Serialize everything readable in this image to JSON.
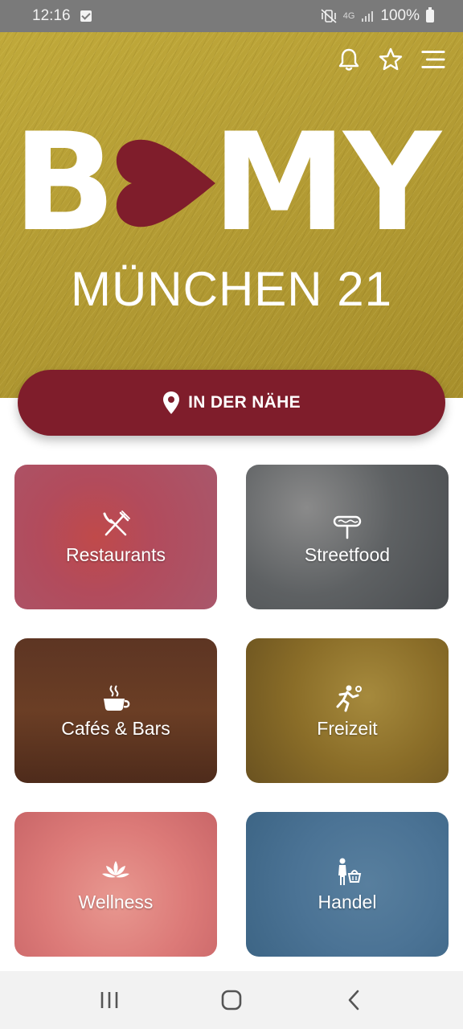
{
  "status_bar": {
    "time": "12:16",
    "network": "4G",
    "battery": "100%"
  },
  "header": {
    "icons": [
      "bell-icon",
      "star-icon",
      "menu-icon"
    ]
  },
  "logo": {
    "left_letter": "B",
    "right_letters": "MY",
    "heart_color": "#7f1d2b",
    "city": "MÜNCHEN 21"
  },
  "nearby_button": {
    "label": "IN DER NÄHE",
    "icon": "location-pin-icon"
  },
  "categories": [
    {
      "label": "Restaurants",
      "icon": "fork-knife-icon"
    },
    {
      "label": "Streetfood",
      "icon": "hotdog-icon"
    },
    {
      "label": "Cafés & Bars",
      "icon": "coffee-cup-icon"
    },
    {
      "label": "Freizeit",
      "icon": "runner-icon"
    },
    {
      "label": "Wellness",
      "icon": "lotus-icon"
    },
    {
      "label": "Handel",
      "icon": "shopper-icon"
    }
  ],
  "nav": [
    "recents-icon",
    "home-icon",
    "back-icon"
  ],
  "colors": {
    "accent": "#7f1d2b",
    "hero": "#b49c34"
  }
}
